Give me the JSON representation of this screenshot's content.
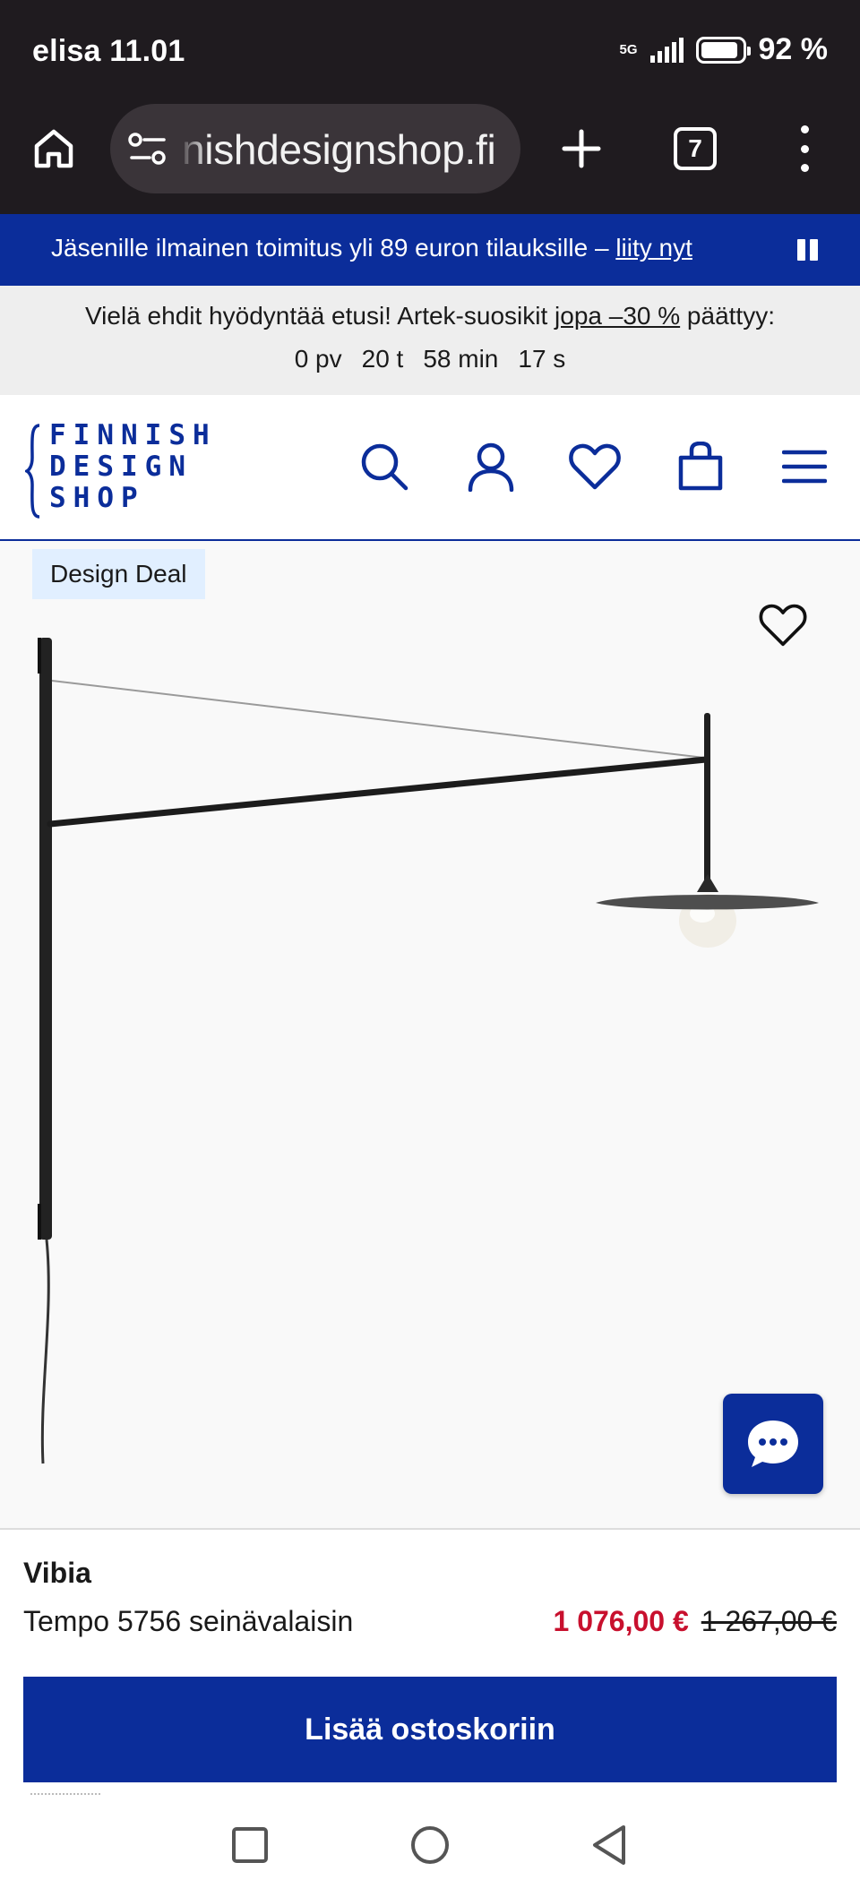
{
  "status_bar": {
    "carrier_time": "elisa 11.01",
    "network": "5G",
    "battery_percent": "92 %",
    "battery_level": 0.92
  },
  "browser": {
    "url": "nishdesignshop.fi",
    "tab_count": "7",
    "icons": {
      "home": "home-icon",
      "site_settings": "tune-icon",
      "new_tab": "plus-icon",
      "tabs": "tabs-icon",
      "menu": "more-vert-icon"
    }
  },
  "member_banner": {
    "text": "Jäsenille ilmainen toimitus yli 89 euron tilauksille – ",
    "link": "liity nyt"
  },
  "deal_banner": {
    "text_before": "Vielä ehdit hyödyntää etusi! Artek-suosikit ",
    "link": "jopa –30 %",
    "text_after": " päättyy:",
    "countdown": [
      "0 pv",
      "20 t",
      "58 min",
      "17 s"
    ]
  },
  "header": {
    "logo_lines": [
      "FINNISH",
      "DESIGN",
      "SHOP"
    ],
    "icons": [
      "search-icon",
      "account-icon",
      "wishlist-icon",
      "cart-icon",
      "menu-icon"
    ]
  },
  "product": {
    "badge": "Design Deal",
    "brand": "Vibia",
    "name": "Tempo 5756 seinävalaisin",
    "price": "1 076,00 €",
    "old_price": "1 267,00 €",
    "add_to_cart": "Lisää ostoskoriin"
  },
  "colors": {
    "brand_blue": "#0b2d9a",
    "sale_red": "#c8102e",
    "badge_bg": "#e1efff"
  }
}
